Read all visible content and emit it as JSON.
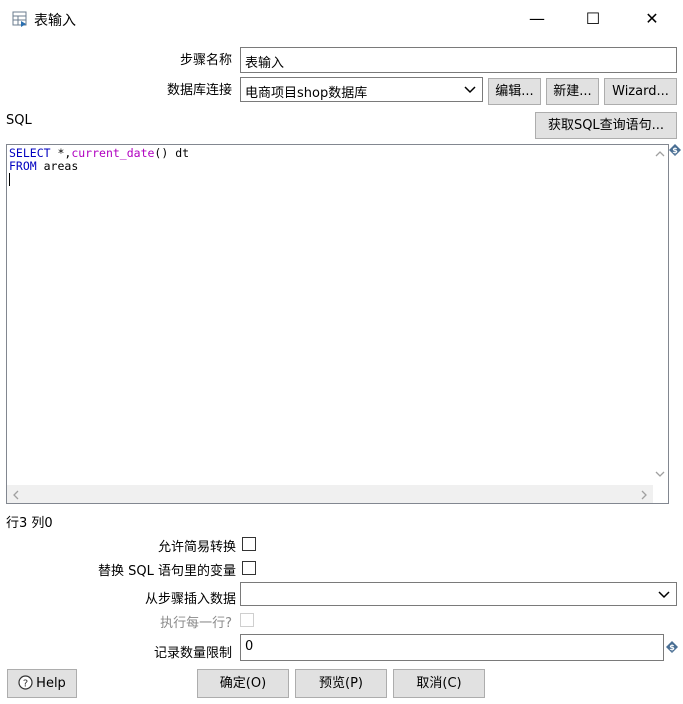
{
  "window": {
    "title": "表输入",
    "controls": {
      "minimize": "—",
      "maximize": "☐",
      "close": "✕"
    }
  },
  "form": {
    "step_name_label": "步骤名称",
    "step_name_value": "表输入",
    "db_connection_label": "数据库连接",
    "db_connection_value": "电商项目shop数据库",
    "edit_button": "编辑...",
    "new_button": "新建...",
    "wizard_button": "Wizard...",
    "sql_label": "SQL",
    "get_sql_button": "获取SQL查询语句..."
  },
  "sql_editor": {
    "line1": {
      "keyword": "SELECT",
      "star": " *,",
      "func": "current_date",
      "rest": "() dt"
    },
    "line2": {
      "keyword": "FROM",
      "rest": " areas"
    },
    "cursor_position": "行3 列0"
  },
  "options": {
    "lazy_conversion_label": "允许简易转换",
    "lazy_conversion_checked": false,
    "replace_vars_label": "替换 SQL 语句里的变量",
    "replace_vars_checked": false,
    "insert_from_step_label": "从步骤插入数据",
    "insert_from_step_value": "",
    "execute_each_row_label": "执行每一行?",
    "execute_each_row_checked": false,
    "limit_label": "记录数量限制",
    "limit_value": "0"
  },
  "footer": {
    "help_button": "Help",
    "ok_button": "确定(O)",
    "preview_button": "预览(P)",
    "cancel_button": "取消(C)"
  },
  "icons": {
    "window_icon": "table-input-icon",
    "variable_icon": "dollar-diamond-icon",
    "help_icon": "question-circle-icon",
    "dropdown": "chevron-down-icon"
  }
}
